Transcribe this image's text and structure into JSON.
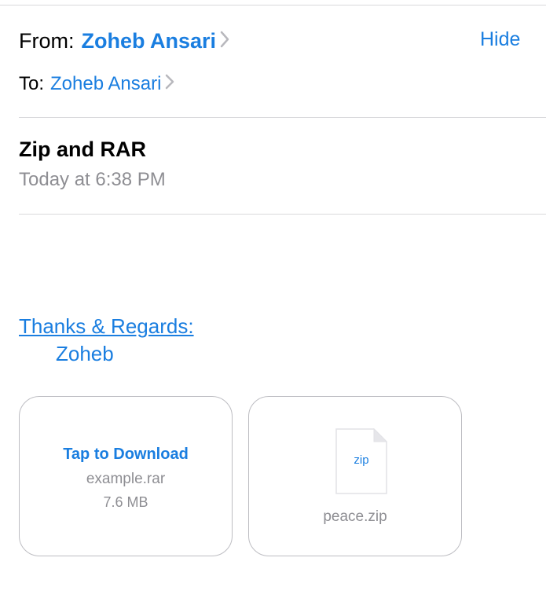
{
  "header": {
    "from_label": "From:",
    "from_name": "Zoheb Ansari",
    "hide_label": "Hide",
    "to_label": "To:",
    "to_name": "Zoheb Ansari"
  },
  "message": {
    "subject": "Zip and RAR",
    "timestamp": "Today at 6:38 PM",
    "signature_link": "Thanks & Regards:",
    "signature_name": "Zoheb"
  },
  "attachments": [
    {
      "action": "Tap to Download",
      "filename": "example.rar",
      "size": "7.6 MB"
    },
    {
      "icon": "document-icon",
      "extension": "zip",
      "filename": "peace.zip"
    }
  ],
  "colors": {
    "accent": "#1a7ee0",
    "secondary_text": "#8e8e93",
    "divider": "#d9d9dc"
  }
}
